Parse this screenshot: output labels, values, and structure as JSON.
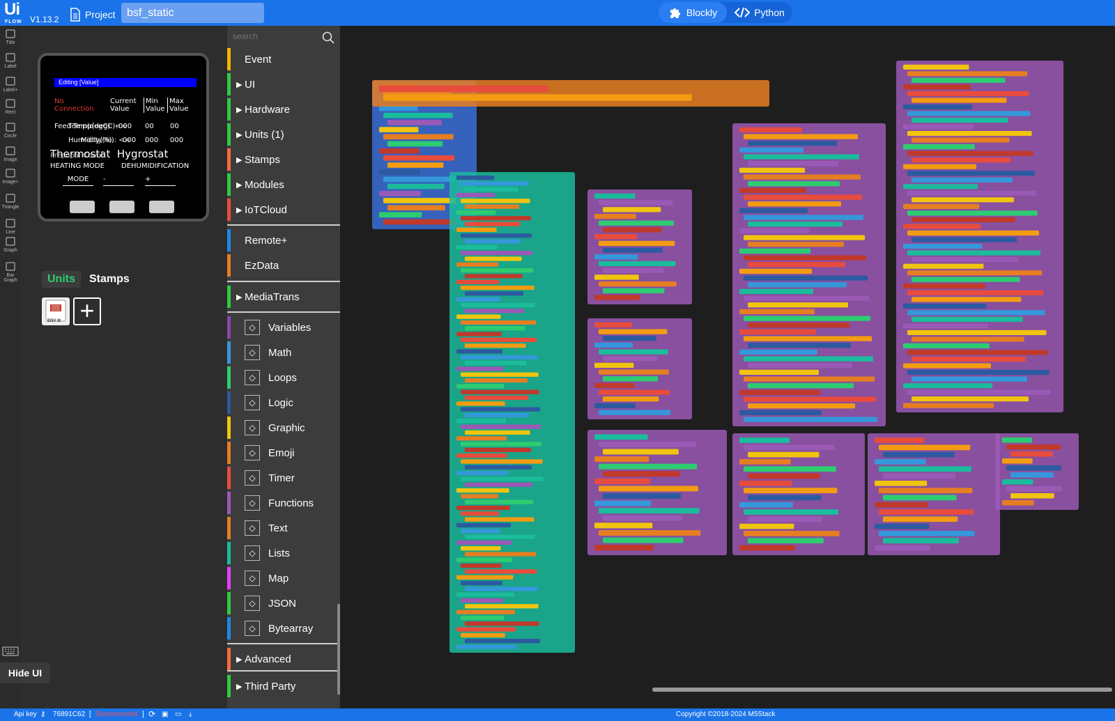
{
  "topbar": {
    "logo_text": "Ui",
    "logo_sub": "FLOW",
    "version": "V1.13.2",
    "project_label": "Project",
    "project_name": "bsf_static",
    "mode_blockly": "Blockly",
    "mode_python": "Python",
    "colors": {
      "bar": "#1a73e8",
      "active_tab": "#2b7ef2"
    }
  },
  "tools": [
    {
      "label": "Title",
      "icon": "title-icon"
    },
    {
      "label": "Label",
      "icon": "tag-icon"
    },
    {
      "label": "Label+",
      "icon": "tag-plus-icon"
    },
    {
      "label": "Rect",
      "icon": "rect-icon"
    },
    {
      "label": "Circle",
      "icon": "circle-icon"
    },
    {
      "label": "Image",
      "icon": "image-icon"
    },
    {
      "label": "Image+",
      "icon": "image-plus-icon"
    },
    {
      "label": "Triangle",
      "icon": "triangle-icon"
    },
    {
      "label": "Line",
      "icon": "line-icon"
    },
    {
      "label": "Graph",
      "icon": "graph-icon"
    },
    {
      "label": "Bar Graph",
      "icon": "bar-graph-icon"
    }
  ],
  "screen": {
    "edit_bar": "Editing [Value]",
    "no_connection": "No Connection",
    "col_current": "Current Value",
    "col_min": "Min Value",
    "col_max": "Max Value",
    "row1_label": "Feed Temp(degC):",
    "row1_overlap": "Temp(degC): <=",
    "row1_values": [
      "000",
      "00",
      "00"
    ],
    "row2_label": "Humidity(%):",
    "row2_overlap": "Midity(%): <=",
    "row2_values": [
      "000",
      "000",
      "000"
    ],
    "title": "Thermostat  Hygrostat",
    "sub_label": "Prepupal Count:",
    "heating": "HEATING MODE",
    "dehum": "DEHUMIDIFICATION",
    "mode": "MODE",
    "minus": "-",
    "plus": "+"
  },
  "panel": {
    "tab_units": "Units",
    "tab_stamps": "Stamps",
    "unit_env_label": "ENV III",
    "hide_ui": "Hide UI"
  },
  "categories": {
    "search_placeholder": "search",
    "items": [
      {
        "label": "Event",
        "color": "#f5b400",
        "arrow": ""
      },
      {
        "label": "UI",
        "color": "#2ecc40",
        "arrow": "▶"
      },
      {
        "label": "Hardware",
        "color": "#2ecc40",
        "arrow": "▶"
      },
      {
        "label": "Units (1)",
        "color": "#2ecc40",
        "arrow": "▶"
      },
      {
        "label": "Stamps",
        "color": "#ff6a3d",
        "arrow": "▶"
      },
      {
        "label": "Modules",
        "color": "#2ecc40",
        "arrow": "▶"
      },
      {
        "label": "IoTCloud",
        "color": "#e74c3c",
        "arrow": "▶"
      },
      {
        "label": "Remote+",
        "color": "#1e88e5",
        "arrow": ""
      },
      {
        "label": "EzData",
        "color": "#e67e22",
        "arrow": ""
      },
      {
        "label": "MediaTrans",
        "color": "#2ecc40",
        "arrow": "▶"
      },
      {
        "label": "Variables",
        "color": "#8e44ad",
        "icon": "variable-icon"
      },
      {
        "label": "Math",
        "color": "#3498db",
        "icon": "math-icon"
      },
      {
        "label": "Loops",
        "color": "#2ecc71",
        "icon": "loop-icon"
      },
      {
        "label": "Logic",
        "color": "#2c5aa0",
        "icon": "logic-icon"
      },
      {
        "label": "Graphic",
        "color": "#f1c40f",
        "icon": "graphic-icon"
      },
      {
        "label": "Emoji",
        "color": "#e67e22",
        "icon": "emoji-icon"
      },
      {
        "label": "Timer",
        "color": "#e74c3c",
        "icon": "timer-icon"
      },
      {
        "label": "Functions",
        "color": "#9b59b6",
        "icon": "functions-icon"
      },
      {
        "label": "Text",
        "color": "#e67e22",
        "icon": "text-icon"
      },
      {
        "label": "Lists",
        "color": "#1abc9c",
        "icon": "list-icon"
      },
      {
        "label": "Map",
        "color": "#e040fb",
        "icon": "map-icon"
      },
      {
        "label": "JSON",
        "color": "#2ecc40",
        "icon": "json-icon"
      },
      {
        "label": "Bytearray",
        "color": "#1e88e5",
        "icon": "bytearray-icon"
      },
      {
        "label": "Advanced",
        "color": "#ff6a3d",
        "arrow": "▶"
      },
      {
        "label": "Third Party",
        "color": "#2ecc40",
        "arrow": "▶"
      }
    ]
  },
  "status": {
    "api_key_label": "Api key",
    "api_key": "76891C62",
    "connection": "Disconnected",
    "copyright": "Copyright ©2018-2024 M5Stack"
  }
}
